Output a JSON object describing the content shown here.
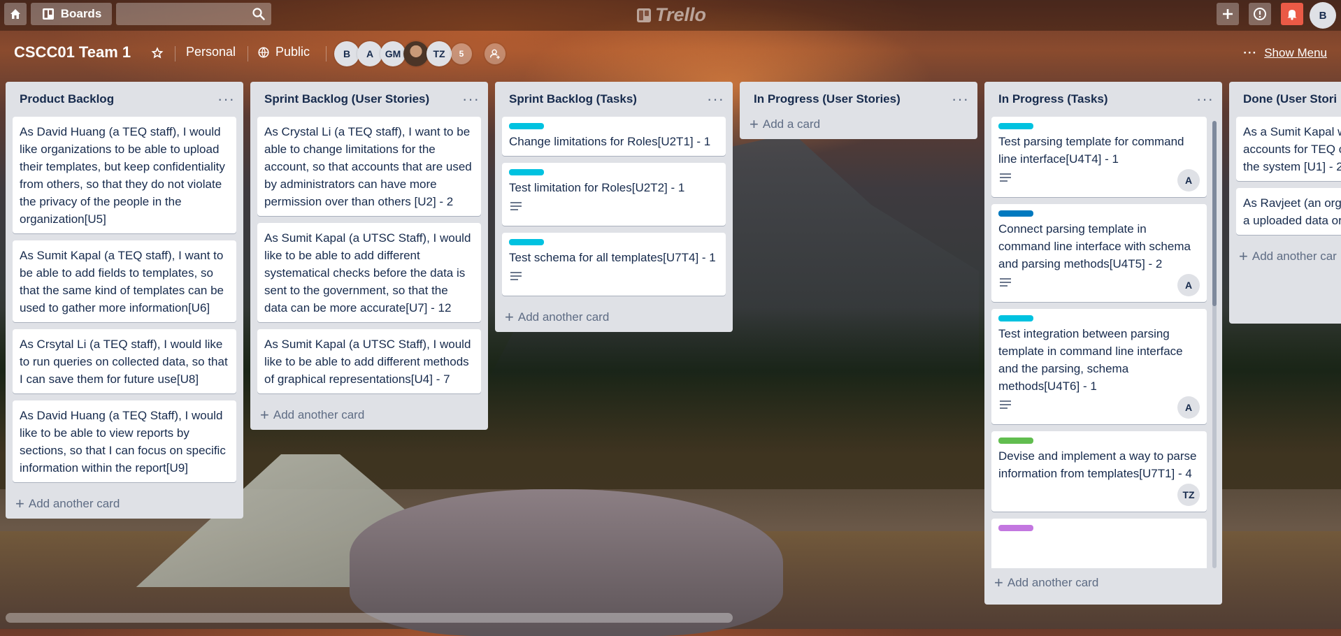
{
  "topbar": {
    "boards_label": "Boards",
    "logo_text": "Trello",
    "notification_color": "#eb5a46",
    "user_initial": "B"
  },
  "board": {
    "title": "CSCC01 Team 1",
    "team": "Personal",
    "visibility": "Public",
    "members": [
      "B",
      "A",
      "GM",
      "",
      "TZ"
    ],
    "more_members_count": "5",
    "show_menu": "Show Menu"
  },
  "lists": [
    {
      "title": "Product Backlog",
      "add_label": "Add another card",
      "cards": [
        {
          "text": "As David Huang (a TEQ staff), I would like organizations to be able to upload their templates, but keep confidentiality from others, so that they do not violate the privacy of the people in the organization[U5]"
        },
        {
          "text": "As Sumit Kapal (a TEQ staff), I want to be able to add fields to templates, so that the same kind of templates can be used to gather more information[U6]"
        },
        {
          "text": "As Crsytal Li (a TEQ staff), I would like to run queries on collected data, so that I can save them for future use[U8]"
        },
        {
          "text": "As David Huang (a TEQ Staff), I would like to be able to view reports by sections, so that I can focus on specific information within the report[U9]"
        }
      ]
    },
    {
      "title": "Sprint Backlog (User Stories)",
      "add_label": "Add another card",
      "cards": [
        {
          "text": "As Crystal Li (a TEQ staff), I want to be able to change limitations for the account, so that accounts that are used by administrators can have more permission over than others [U2] - 2"
        },
        {
          "text": "As Sumit Kapal (a UTSC Staff), I would like to be able to add different systematical checks before the data is sent to the government, so that the data can be more accurate[U7] - 12"
        },
        {
          "text": "As Sumit Kapal (a UTSC Staff), I would like to be able to add different methods of graphical representations[U4] - 7"
        }
      ]
    },
    {
      "title": "Sprint Backlog (Tasks)",
      "add_label": "Add another card",
      "cards": [
        {
          "label_color": "#00c2e0",
          "text": "Change limitations for Roles[U2T1] - 1"
        },
        {
          "label_color": "#00c2e0",
          "text": "Test limitation for Roles[U2T2] - 1",
          "has_description": true
        },
        {
          "label_color": "#00c2e0",
          "text": "Test schema for all templates[U7T4] - 1",
          "has_description": true
        }
      ]
    },
    {
      "title": "In Progress (User Stories)",
      "add_label": "Add a card",
      "cards": []
    },
    {
      "title": "In Progress (Tasks)",
      "add_label": "Add another card",
      "cards": [
        {
          "label_color": "#00c2e0",
          "text": "Test parsing template for command line interface[U4T4] - 1",
          "has_description": true,
          "member": "A"
        },
        {
          "label_color": "#0079bf",
          "text": "Connect parsing template in command line interface with schema and parsing methods[U4T5] - 2",
          "has_description": true,
          "member": "A"
        },
        {
          "label_color": "#00c2e0",
          "text": "Test integration between parsing template in command line interface and the parsing, schema methods[U4T6] - 1",
          "has_description": true,
          "member": "A"
        },
        {
          "label_color": "#61bd4f",
          "text": "Devise and implement a way to parse information from templates[U7T1] - 4",
          "member": "TZ"
        },
        {
          "label_color": "#c377e0",
          "text": ""
        }
      ]
    },
    {
      "title": "Done (User Stori",
      "add_label": "Add another car",
      "cards": [
        {
          "text": "As a Sumit Kapal would like to be ab accounts for TEQ organizations, so t the system [U1] - 2"
        },
        {
          "text": "As Ravjeet (an org I would like to be a uploaded data or m"
        }
      ]
    }
  ]
}
